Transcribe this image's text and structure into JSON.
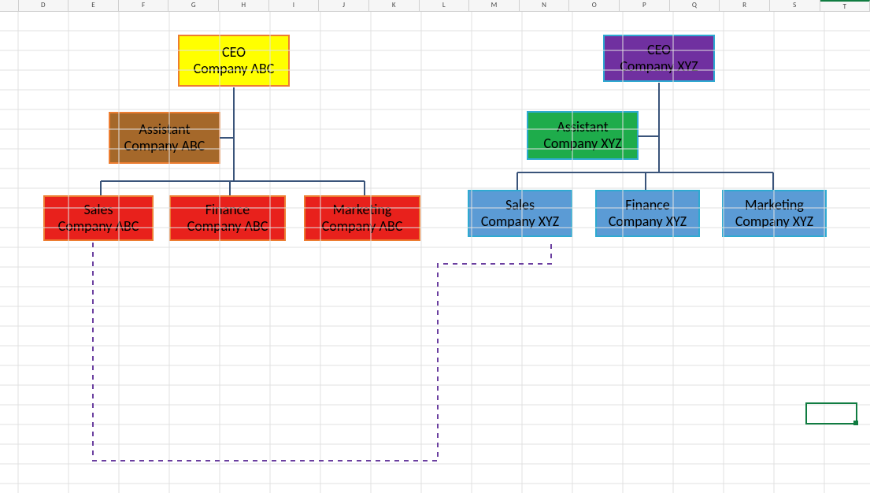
{
  "columns": [
    "D",
    "E",
    "F",
    "G",
    "H",
    "I",
    "J",
    "K",
    "L",
    "M",
    "N",
    "O",
    "P",
    "Q",
    "R",
    "S",
    "T"
  ],
  "abc": {
    "ceo": {
      "role": "CEO",
      "company": "Company ABC"
    },
    "assistant": {
      "role": "Assistant",
      "company": "Company ABC"
    },
    "sales": {
      "role": "Sales",
      "company": "Company ABC"
    },
    "finance": {
      "role": "Finance",
      "company": "Company ABC"
    },
    "marketing": {
      "role": "Marketing",
      "company": "Company ABC"
    }
  },
  "xyz": {
    "ceo": {
      "role": "CEO",
      "company": "Company XYZ"
    },
    "assistant": {
      "role": "Assistant",
      "company": "Company XYZ"
    },
    "sales": {
      "role": "Sales",
      "company": "Company XYZ"
    },
    "finance": {
      "role": "Finance",
      "company": "Company XYZ"
    },
    "marketing": {
      "role": "Marketing",
      "company": "Company XYZ"
    }
  },
  "colors": {
    "abc_ceo": "#ffff00",
    "abc_assistant": "#a5682a",
    "abc_dept": "#e8211c",
    "abc_border": "#ed7d31",
    "xyz_ceo": "#7030a0",
    "xyz_assistant": "#1eac4b",
    "xyz_dept": "#5b9bd5",
    "xyz_border": "#2faad1",
    "connector": "#3a547a",
    "dashed_connector": "#6b3fa0",
    "selection": "#107c41"
  },
  "chart_data": {
    "type": "diagram",
    "description": "Two side-by-side organizational hierarchy charts drawn on an Excel sheet, with a dashed dotted-line relationship linking the Sales department of Company ABC to the Sales department of Company XYZ.",
    "orgs": [
      {
        "name": "Company ABC",
        "palette": {
          "ceo": "#ffff00",
          "assistant": "#a5682a",
          "department": "#e8211c",
          "border": "#ed7d31"
        },
        "root": {
          "role": "CEO",
          "company": "Company ABC",
          "assistant": {
            "role": "Assistant",
            "company": "Company ABC"
          },
          "children": [
            {
              "role": "Sales",
              "company": "Company ABC"
            },
            {
              "role": "Finance",
              "company": "Company ABC"
            },
            {
              "role": "Marketing",
              "company": "Company ABC"
            }
          ]
        }
      },
      {
        "name": "Company XYZ",
        "palette": {
          "ceo": "#7030a0",
          "assistant": "#1eac4b",
          "department": "#5b9bd5",
          "border": "#2faad1"
        },
        "root": {
          "role": "CEO",
          "company": "Company XYZ",
          "assistant": {
            "role": "Assistant",
            "company": "Company XYZ"
          },
          "children": [
            {
              "role": "Sales",
              "company": "Company XYZ"
            },
            {
              "role": "Finance",
              "company": "Company XYZ"
            },
            {
              "role": "Marketing",
              "company": "Company XYZ"
            }
          ]
        }
      }
    ],
    "cross_links": [
      {
        "from": "Company ABC / Sales",
        "to": "Company XYZ / Sales",
        "style": "dashed"
      }
    ]
  }
}
